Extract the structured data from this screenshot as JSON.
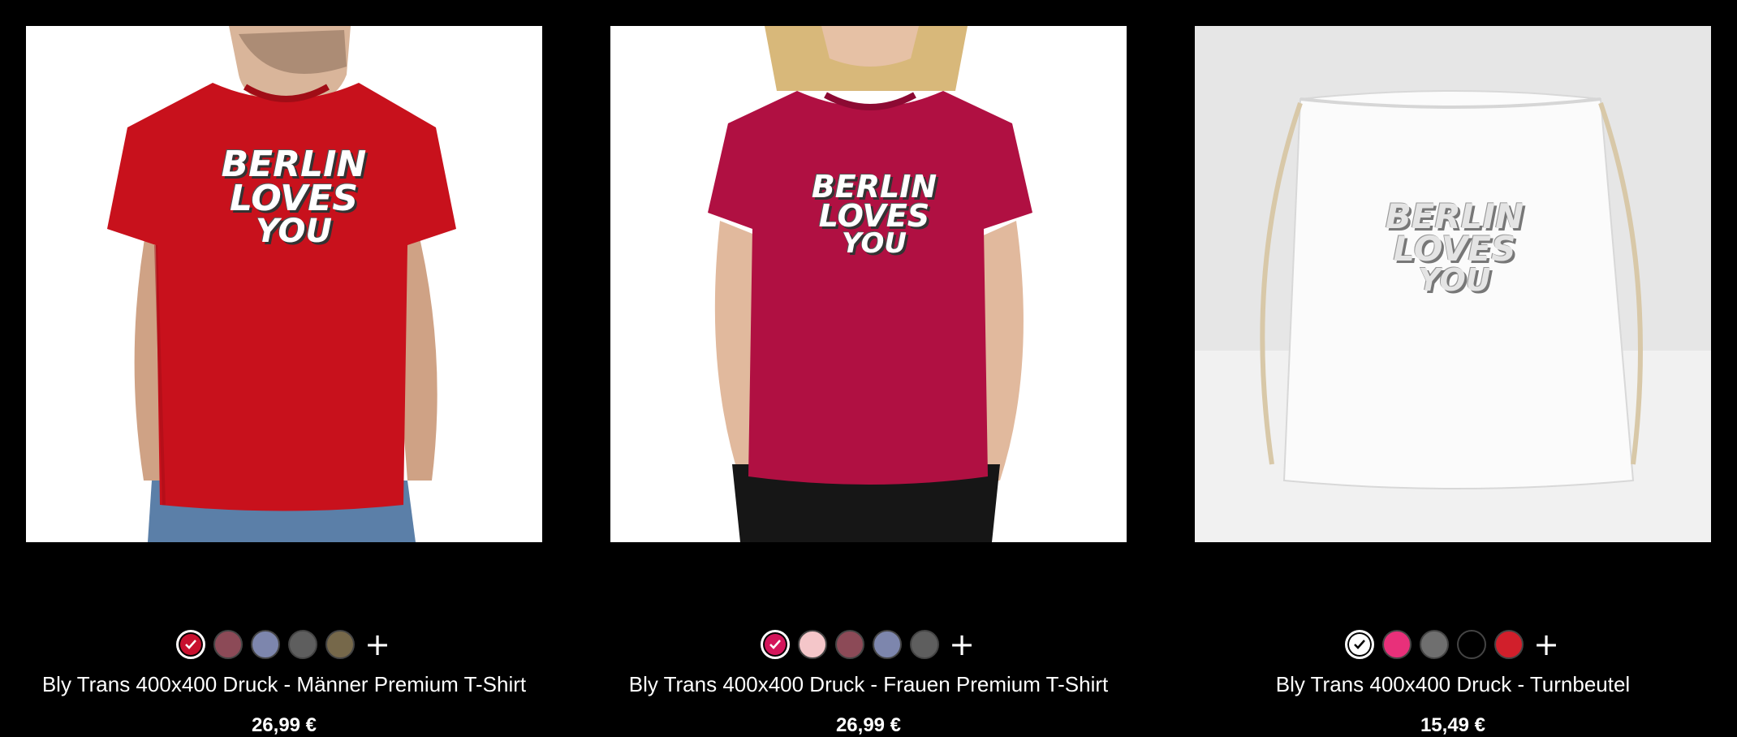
{
  "products": [
    {
      "title": "Bly Trans 400x400 Druck - Männer Premium T-Shirt",
      "price": "26,99 €",
      "image_background": "#ffffff",
      "product_color": "#c8111c",
      "design_fill": "#ffffff",
      "swatches": [
        {
          "color": "#c8102e",
          "selected": true
        },
        {
          "color": "#8c4a57",
          "selected": false
        },
        {
          "color": "#7d86ad",
          "selected": false
        },
        {
          "color": "#5e5e5e",
          "selected": false
        },
        {
          "color": "#76684a",
          "selected": false
        }
      ],
      "more_label": "+"
    },
    {
      "title": "Bly Trans 400x400 Druck - Frauen Premium T-Shirt",
      "price": "26,99 €",
      "image_background": "#ffffff",
      "product_color": "#b01042",
      "design_fill": "#ffffff",
      "swatches": [
        {
          "color": "#d4145a",
          "selected": true
        },
        {
          "color": "#f4c6c9",
          "selected": false
        },
        {
          "color": "#8c4a57",
          "selected": false
        },
        {
          "color": "#7d86ad",
          "selected": false
        },
        {
          "color": "#5e5e5e",
          "selected": false
        }
      ],
      "more_label": "+"
    },
    {
      "title": "Bly Trans 400x400 Druck - Turnbeutel",
      "price": "15,49 €",
      "image_background": "#e8e8e8",
      "product_color": "#ffffff",
      "design_fill": "#e4e4e4",
      "swatches": [
        {
          "color": "#ffffff",
          "selected": true
        },
        {
          "color": "#e8307a",
          "selected": false
        },
        {
          "color": "#6f6f6f",
          "selected": false
        },
        {
          "color": "#000000",
          "selected": false
        },
        {
          "color": "#d11f2b",
          "selected": false
        }
      ],
      "more_label": "+"
    }
  ],
  "design_text": [
    "BERLIN",
    "LOVES",
    "YOU"
  ]
}
